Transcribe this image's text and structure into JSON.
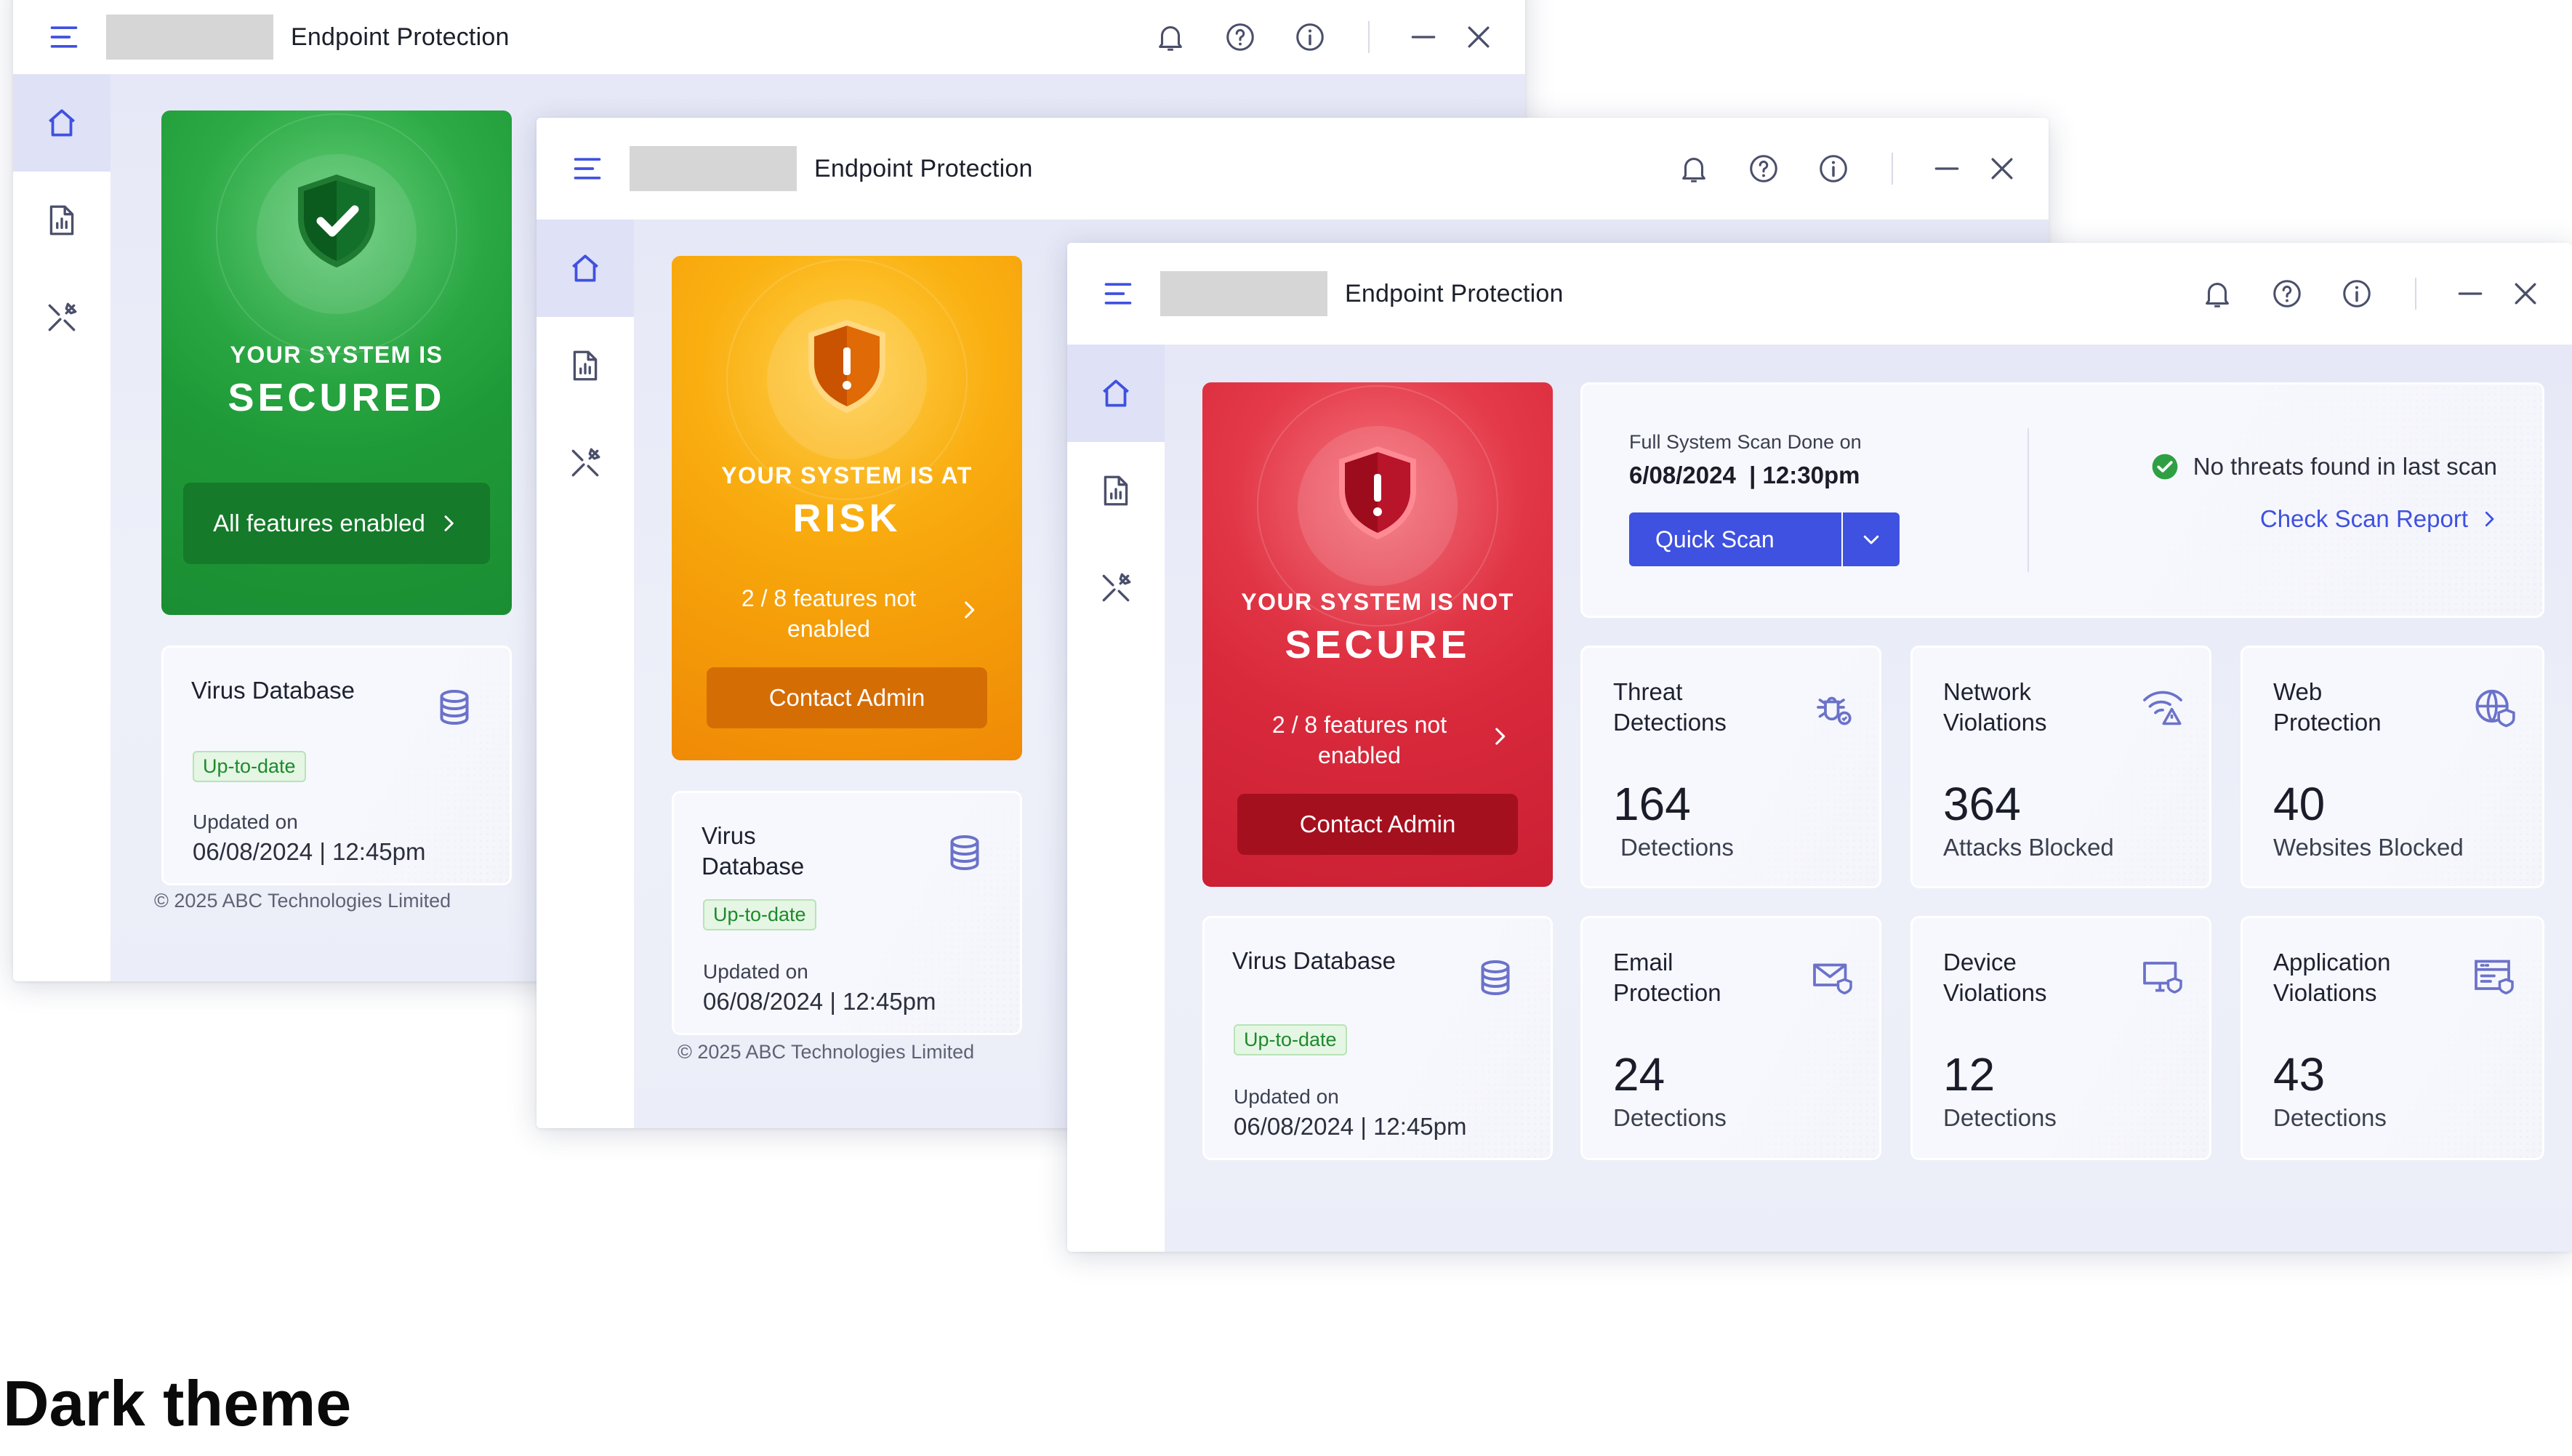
{
  "app": {
    "title": "Endpoint Protection",
    "copyright": "© 2025 ABC Technologies Limited"
  },
  "colors": {
    "accent": "#3f51e0",
    "secured": "#1f9a38",
    "risk": "#f6a20a",
    "notsecure": "#d92a3c"
  },
  "windows": {
    "secured": {
      "status_line1": "YOUR SYSTEM IS",
      "status_line2": "SECURED",
      "button": "All features enabled"
    },
    "risk": {
      "status_line1": "YOUR SYSTEM IS AT",
      "status_line2": "RISK",
      "features": "2 / 8 features not enabled",
      "button": "Contact Admin"
    },
    "notsecure": {
      "status_line1": "YOUR SYSTEM IS NOT",
      "status_line2": "SECURE",
      "features": "2 / 8 features not enabled",
      "button": "Contact Admin"
    }
  },
  "virus_db": {
    "title": "Virus Database",
    "title_line1": "Virus",
    "title_line2": "Database",
    "badge": "Up-to-date",
    "updated_label": "Updated on",
    "updated_value": "06/08/2024 | 12:45pm"
  },
  "scan": {
    "label": "Full System Scan Done on",
    "date": "6/08/2024  | 12:30pm",
    "quick_scan": "Quick Scan",
    "no_threats": "No threats found in last scan",
    "report": "Check Scan Report"
  },
  "stats": [
    {
      "title1": "Threat",
      "title2": "Detections",
      "value": "164",
      "caption": "Detections",
      "icon": "bug-icon"
    },
    {
      "title1": "Network",
      "title2": "Violations",
      "value": "364",
      "caption": "Attacks Blocked",
      "icon": "wifi-warning-icon"
    },
    {
      "title1": "Web",
      "title2": "Protection",
      "value": "40",
      "caption": "Websites Blocked",
      "icon": "globe-shield-icon"
    },
    {
      "title1": "Email",
      "title2": "Protection",
      "value": "24",
      "caption": "Detections",
      "icon": "mail-shield-icon"
    },
    {
      "title1": "Device",
      "title2": "Violations",
      "value": "12",
      "caption": "Detections",
      "icon": "monitor-shield-icon"
    },
    {
      "title1": "Application",
      "title2": "Violations",
      "value": "43",
      "caption": "Detections",
      "icon": "app-window-shield-icon"
    }
  ],
  "theme_label": "Dark theme"
}
